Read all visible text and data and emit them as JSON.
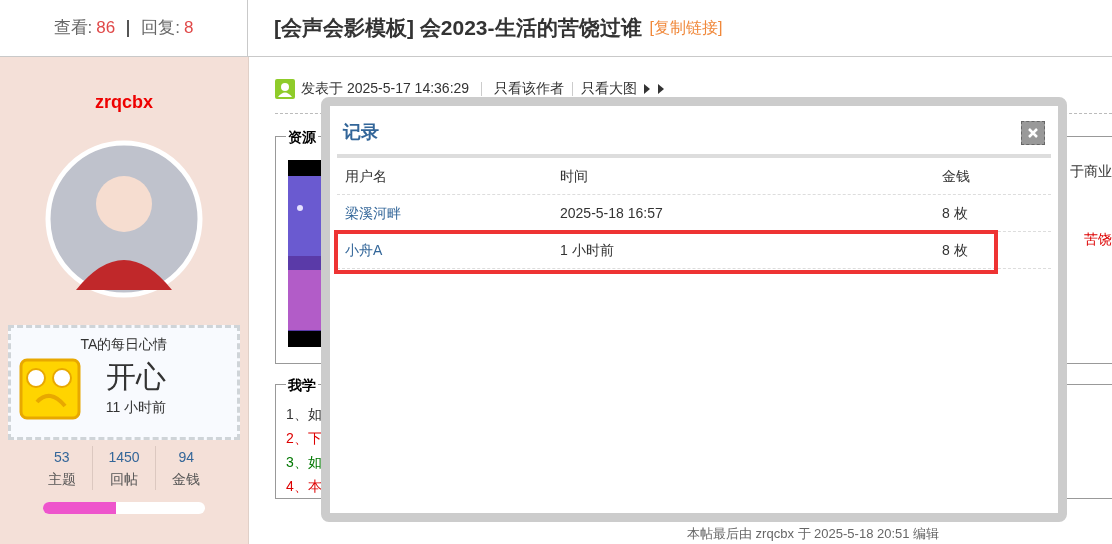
{
  "thread_stats": {
    "views_label": "查看:",
    "views": "86",
    "replies_label": "回复:",
    "replies": "8"
  },
  "thread_title": "[会声会影模板] 会2023-生活的苦饶过谁",
  "copy_link": "[复制链接]",
  "author": {
    "name": "zrqcbx",
    "mood": {
      "title": "TA的每日心情",
      "mood": "开心",
      "time": "11 小时前"
    },
    "stats": [
      {
        "value": "53",
        "label": "主题"
      },
      {
        "value": "1450",
        "label": "回帖"
      },
      {
        "value": "94",
        "label": "金钱"
      }
    ],
    "level": 0.45
  },
  "post": {
    "posted": "发表于 2025-5-17 14:36:29",
    "links": [
      "只看该作者",
      "只看大图"
    ],
    "section_1": {
      "legend": "资源",
      "right_text": "于商业",
      "right_text_2": "苦饶"
    },
    "section_2": {
      "legend": "我学",
      "lines": [
        {
          "text": "1、如",
          "color": "#333333"
        },
        {
          "text": "2、下",
          "color": "#dd0000"
        },
        {
          "text": "3、如",
          "color": "#007700"
        },
        {
          "text": "4、本",
          "color": "#dd0000"
        }
      ]
    },
    "edit_note": "本帖最后由 zrqcbx 于 2025-5-18 20:51 编辑"
  },
  "dialog": {
    "title": "记录",
    "columns": [
      "用户名",
      "时间",
      "金钱"
    ],
    "rows": [
      {
        "user": "梁溪河畔",
        "time": "2025-5-18 16:57",
        "amount": "8 枚",
        "highlighted": false
      },
      {
        "user": "小舟A",
        "time": "1 小时前",
        "amount": "8 枚",
        "highlighted": true
      }
    ]
  }
}
